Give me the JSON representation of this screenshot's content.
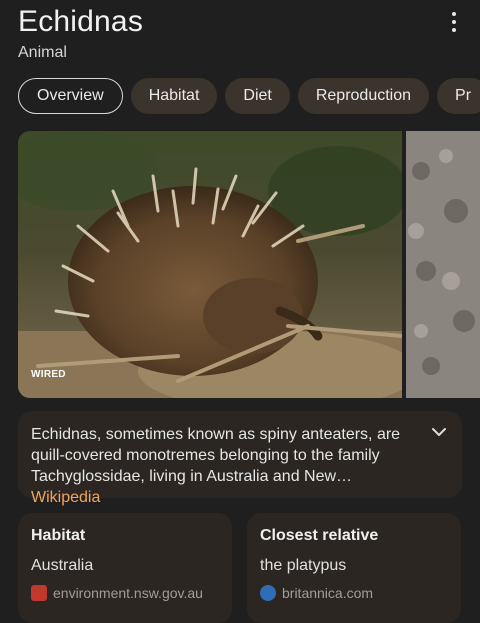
{
  "header": {
    "title": "Echidnas",
    "subtitle": "Animal"
  },
  "tabs": [
    {
      "label": "Overview",
      "active": true
    },
    {
      "label": "Habitat",
      "active": false
    },
    {
      "label": "Diet",
      "active": false
    },
    {
      "label": "Reproduction",
      "active": false
    },
    {
      "label": "Pr",
      "active": false
    }
  ],
  "image": {
    "credit": "WIRED"
  },
  "description": {
    "text": "Echidnas, sometimes known as spiny anteaters, are quill-covered monotremes belonging to the family Tachyglossidae, living in Australia and New… ",
    "source": "Wikipedia"
  },
  "cards": [
    {
      "heading": "Habitat",
      "value": "Australia",
      "source": "environment.nsw.gov.au"
    },
    {
      "heading": "Closest relative",
      "value": "the platypus",
      "source": "britannica.com"
    }
  ],
  "colors": {
    "background": "#1f1f1f",
    "chip": "#3b342c",
    "card": "#2b2621",
    "link": "#f2a35e"
  }
}
